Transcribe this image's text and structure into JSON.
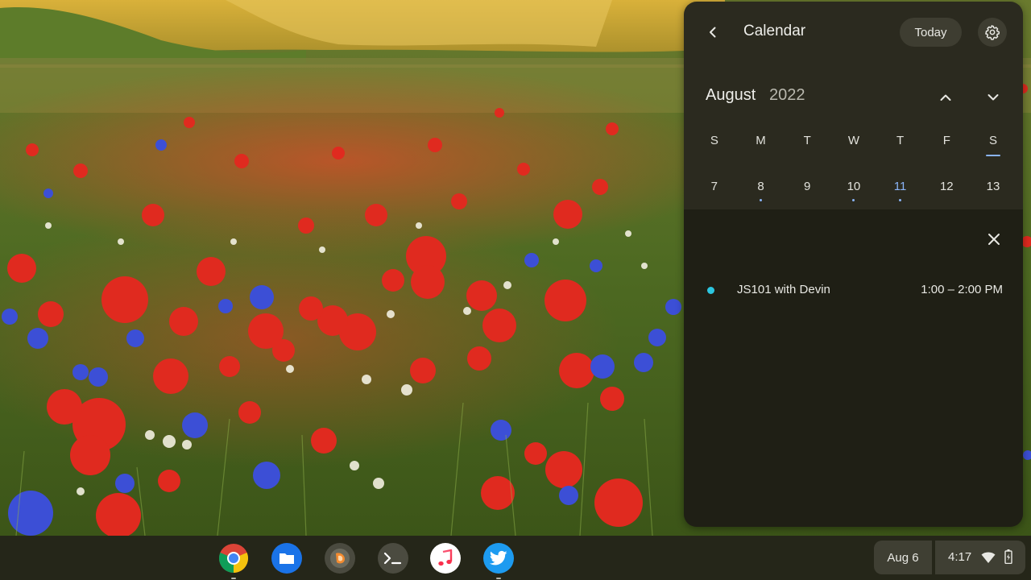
{
  "calendar": {
    "title": "Calendar",
    "today_label": "Today",
    "month": "August",
    "year": "2022",
    "weekdays": [
      "S",
      "M",
      "T",
      "W",
      "T",
      "F",
      "S"
    ],
    "days": [
      {
        "label": "7",
        "has_event": false,
        "is_today": false
      },
      {
        "label": "8",
        "has_event": true,
        "is_today": false
      },
      {
        "label": "9",
        "has_event": false,
        "is_today": false
      },
      {
        "label": "10",
        "has_event": true,
        "is_today": false
      },
      {
        "label": "11",
        "has_event": true,
        "is_today": true
      },
      {
        "label": "12",
        "has_event": false,
        "is_today": false
      },
      {
        "label": "13",
        "has_event": false,
        "is_today": false
      }
    ],
    "event": {
      "title": "JS101 with Devin",
      "time": "1:00 – 2:00 PM",
      "color": "#2cc6e0"
    },
    "accent_color": "#8ab4f8"
  },
  "shelf": {
    "apps": [
      {
        "name": "chrome-icon",
        "running": true
      },
      {
        "name": "files-icon",
        "running": false
      },
      {
        "name": "app-icon",
        "running": false
      },
      {
        "name": "terminal-icon",
        "running": false
      },
      {
        "name": "music-icon",
        "running": false
      },
      {
        "name": "twitter-icon",
        "running": true
      }
    ],
    "date": "Aug 6",
    "time": "4:17"
  }
}
